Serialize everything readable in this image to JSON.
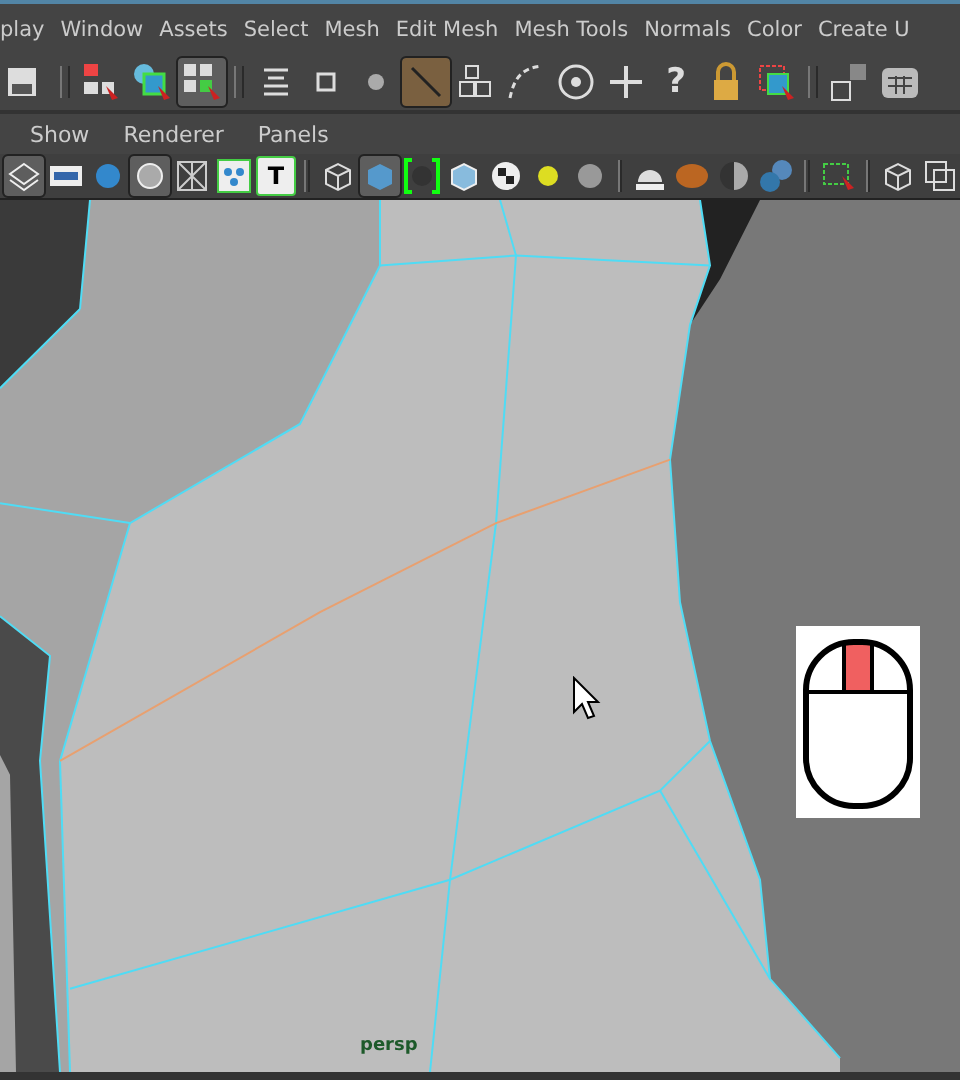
{
  "main_menu": [
    {
      "label": "play"
    },
    {
      "label": "Window"
    },
    {
      "label": "Assets"
    },
    {
      "label": "Select"
    },
    {
      "label": "Mesh"
    },
    {
      "label": "Edit Mesh"
    },
    {
      "label": "Mesh Tools"
    },
    {
      "label": "Normals"
    },
    {
      "label": "Color"
    },
    {
      "label": "Create U"
    }
  ],
  "status_toolbar": [
    {
      "kind": "save",
      "selected": false
    },
    {
      "kind": "sep"
    },
    {
      "kind": "hierarchy",
      "selected": false
    },
    {
      "kind": "object",
      "selected": false
    },
    {
      "kind": "component",
      "selected": true
    },
    {
      "kind": "sep"
    },
    {
      "kind": "levels",
      "selected": false
    },
    {
      "kind": "square",
      "selected": false
    },
    {
      "kind": "dot",
      "selected": false
    },
    {
      "kind": "edge",
      "selected": true
    },
    {
      "kind": "faces",
      "selected": false
    },
    {
      "kind": "curve",
      "selected": false
    },
    {
      "kind": "target",
      "selected": false
    },
    {
      "kind": "plus",
      "selected": false
    },
    {
      "kind": "glyph",
      "glyph": "?",
      "selected": false
    },
    {
      "kind": "lock",
      "selected": false
    },
    {
      "kind": "marquee",
      "selected": false
    },
    {
      "kind": "sep"
    },
    {
      "kind": "snap",
      "selected": false
    },
    {
      "kind": "calendar",
      "selected": false
    }
  ],
  "panel_menu": [
    {
      "label": "Show"
    },
    {
      "label": "Renderer"
    },
    {
      "label": "Panels"
    }
  ],
  "panel_toolbar": [
    {
      "kind": "layers",
      "selected": true
    },
    {
      "kind": "film",
      "selected": false
    },
    {
      "kind": "sphere",
      "selected": false
    },
    {
      "kind": "circle",
      "selected": true
    },
    {
      "kind": "wiregrid",
      "selected": false
    },
    {
      "kind": "nodes",
      "selected": false
    },
    {
      "kind": "glyph",
      "glyph": "T",
      "selected": false
    },
    {
      "kind": "sep"
    },
    {
      "kind": "wirecube",
      "selected": false
    },
    {
      "kind": "shadedcube",
      "selected": true
    },
    {
      "kind": "bracket",
      "selected": false
    },
    {
      "kind": "cube",
      "selected": false
    },
    {
      "kind": "checker",
      "selected": false
    },
    {
      "kind": "light",
      "selected": false
    },
    {
      "kind": "graysphere",
      "selected": false
    },
    {
      "kind": "sep"
    },
    {
      "kind": "dome",
      "selected": false
    },
    {
      "kind": "bronze",
      "selected": false
    },
    {
      "kind": "halfsphere",
      "selected": false
    },
    {
      "kind": "blobs",
      "selected": false
    },
    {
      "kind": "sep"
    },
    {
      "kind": "marquee",
      "selected": false
    },
    {
      "kind": "sep"
    },
    {
      "kind": "wirecube",
      "selected": false
    },
    {
      "kind": "squares",
      "selected": false
    }
  ],
  "viewport": {
    "camera": "persp",
    "mouse_buttons": [
      {
        "selected": false
      },
      {
        "selected": true
      },
      {
        "selected": false
      }
    ]
  }
}
